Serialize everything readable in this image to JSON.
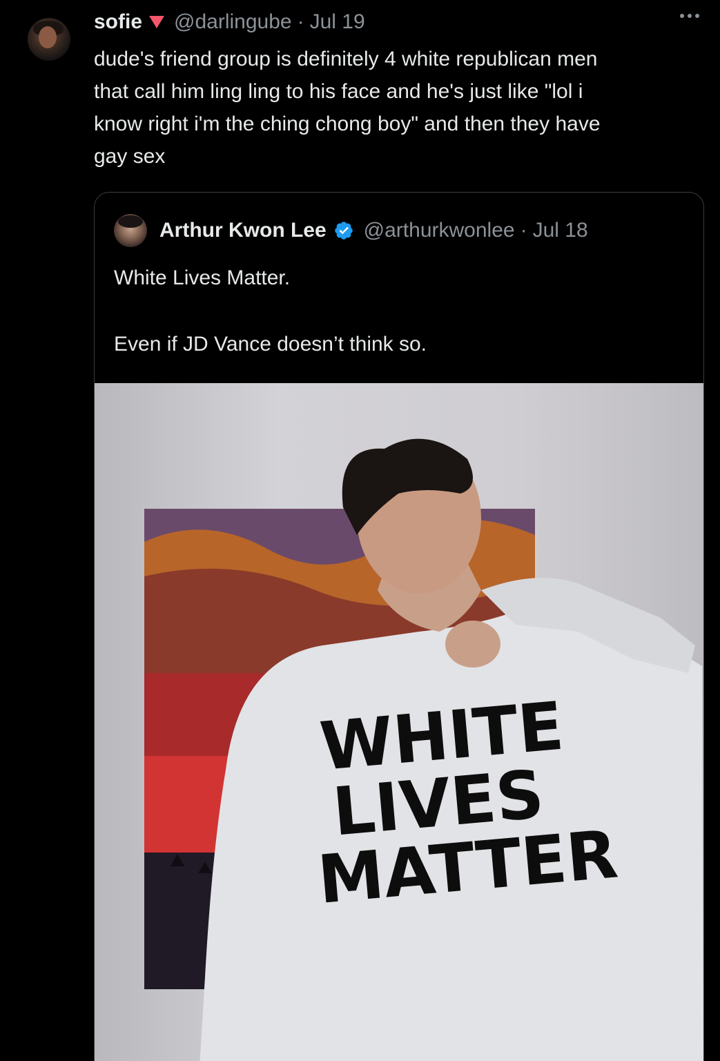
{
  "tweet": {
    "author_name": "sofie",
    "author_handle": "@darlingube",
    "separator": "·",
    "date": "Jul 19",
    "text": "dude's friend group is definitely 4 white republican men\nthat call him ling ling to his face and he's just like \"lol i\nknow right i'm the ching chong boy\" and then they have\ngay sex",
    "badge_color": "#f2576b",
    "more_icon": "more-horizontal-icon"
  },
  "quoted_tweet": {
    "author_name": "Arthur Kwon Lee",
    "author_handle": "@arthurkwonlee",
    "separator": "·",
    "date": "Jul 18",
    "verified": true,
    "verified_color": "#1d9bf0",
    "text": "White Lives Matter.\n\nEven if JD Vance doesn’t think so.",
    "photo": {
      "shirt_lines": [
        "WHITE",
        "LIVES",
        "MATTER"
      ]
    }
  }
}
